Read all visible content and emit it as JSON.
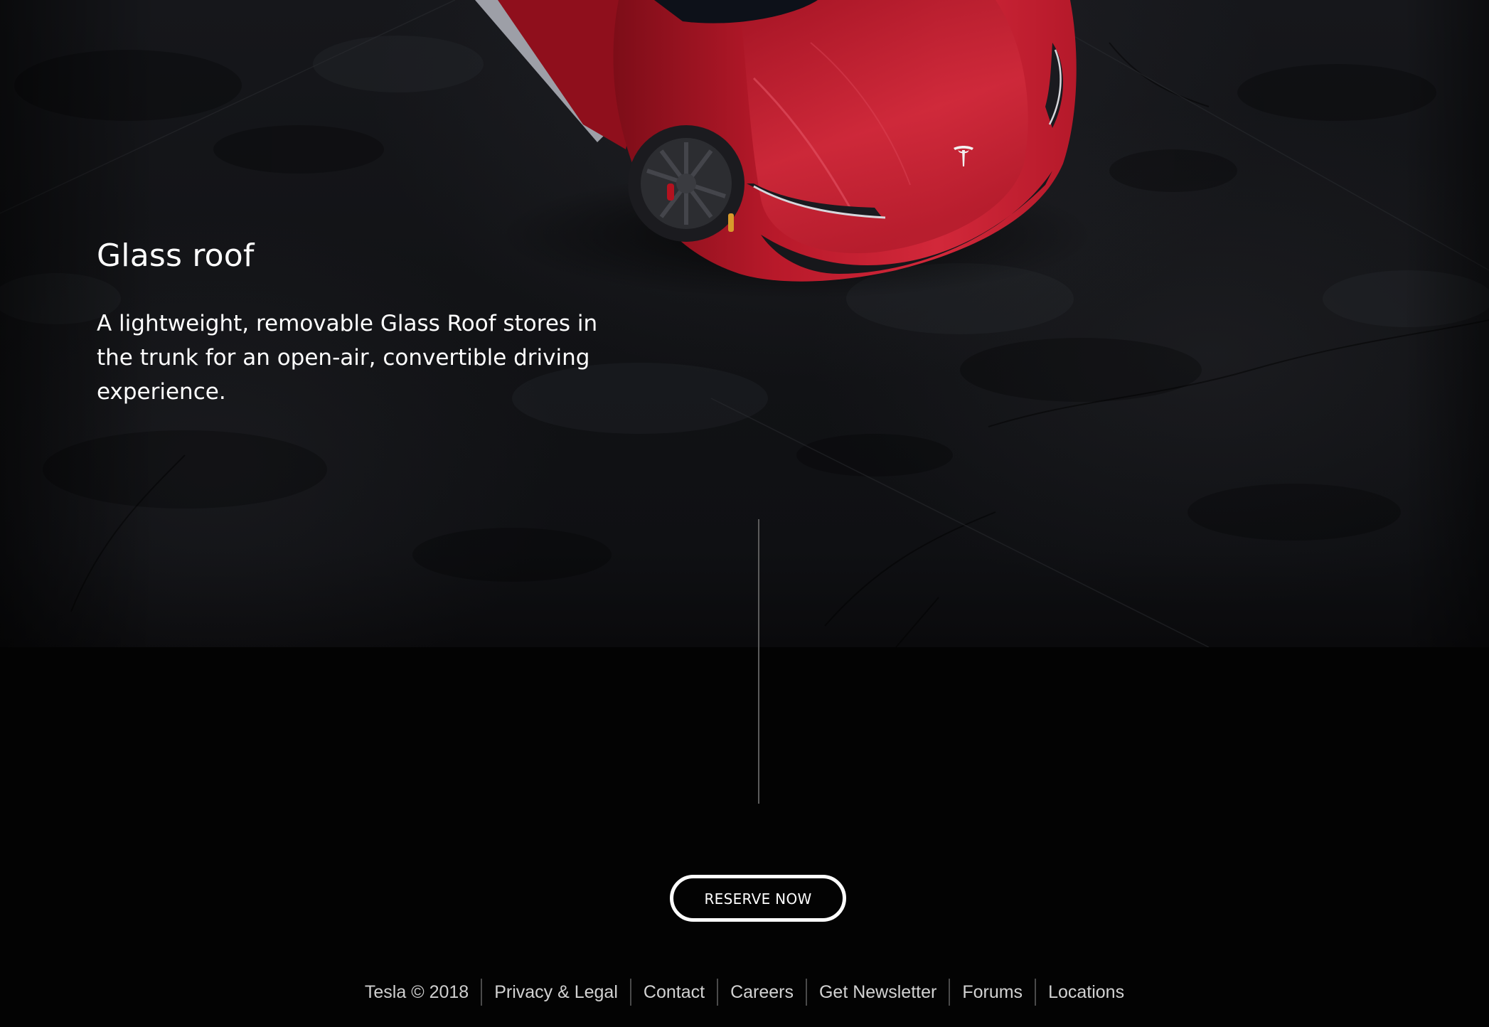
{
  "feature": {
    "title": "Glass roof",
    "description": "A lightweight, removable Glass Roof stores in the trunk for an open-air, convertible driving experience."
  },
  "cta": {
    "reserve_label": "RESERVE NOW"
  },
  "footer": {
    "copyright": "Tesla © 2018",
    "links": [
      "Privacy & Legal",
      "Contact",
      "Careers",
      "Get Newsletter",
      "Forums",
      "Locations"
    ]
  },
  "hero_image": {
    "subject": "red-roadster-top-down",
    "car_color": "#c4202e"
  },
  "colors": {
    "background": "#030303",
    "text": "#ffffff",
    "divider": "#5c5c5c",
    "footer_text": "#cfcfcf"
  }
}
